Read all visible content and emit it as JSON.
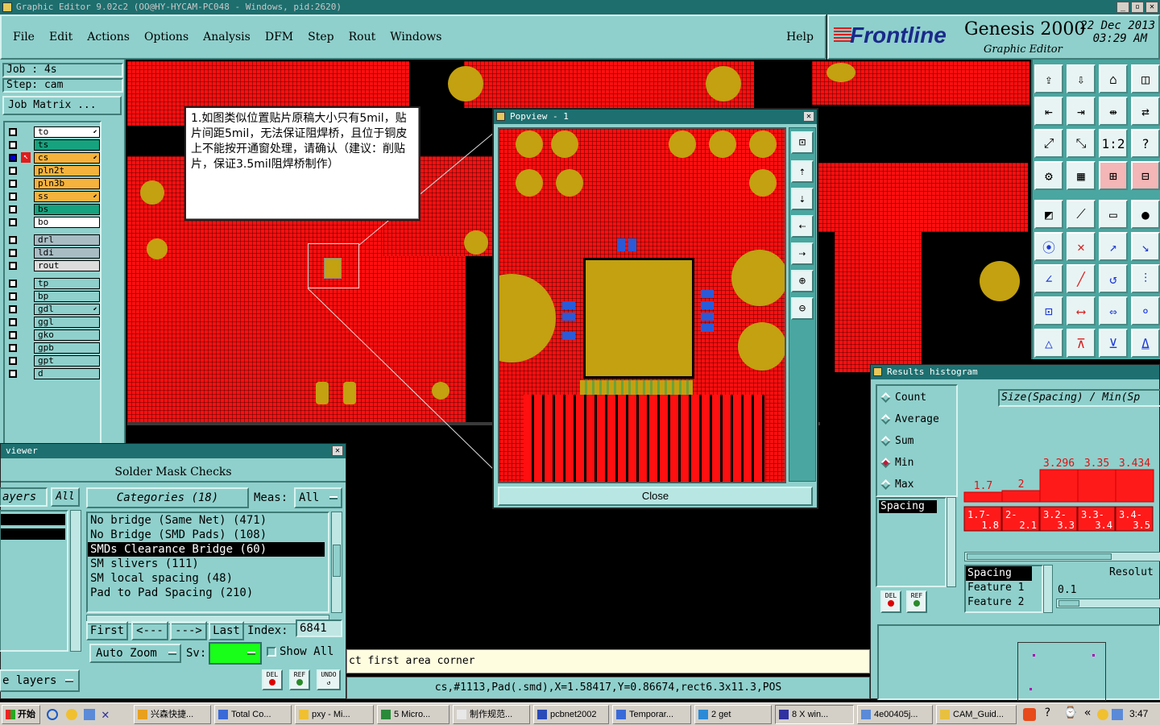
{
  "window": {
    "title": "Graphic Editor 9.02c2  (OO@HY-HYCAM-PC048 - Windows, pid:2620)"
  },
  "menu": [
    "File",
    "Edit",
    "Actions",
    "Options",
    "Analysis",
    "DFM",
    "Step",
    "Rout",
    "Windows"
  ],
  "help": "Help",
  "brand": {
    "logo": "Frontline",
    "product": "Genesis 2000",
    "subtitle": "Graphic Editor",
    "date": "22 Dec 2013",
    "time": "03:29 AM"
  },
  "job": {
    "job": "Job : 4s",
    "step": "Step: cam",
    "matrix": "Job Matrix ..."
  },
  "layers": [
    {
      "name": "to",
      "color": "#ffffff"
    },
    {
      "name": "ts",
      "color": "#16a27e"
    },
    {
      "name": "cs",
      "color": "#f5b23c"
    },
    {
      "name": "pln2t",
      "color": "#f5b23c"
    },
    {
      "name": "pln3b",
      "color": "#f5b23c"
    },
    {
      "name": "ss",
      "color": "#f5b23c"
    },
    {
      "name": "bs",
      "color": "#16a27e"
    },
    {
      "name": "bo",
      "color": "#ffffff"
    },
    {
      "name": "drl",
      "color": "#a8bcc4"
    },
    {
      "name": "ldi",
      "color": "#a8bcc4"
    },
    {
      "name": "rout",
      "color": "#dcdcdc"
    },
    {
      "name": "tp",
      "color": "#8fd0cc"
    },
    {
      "name": "bp",
      "color": "#8fd0cc"
    },
    {
      "name": "gdl",
      "color": "#8fd0cc"
    },
    {
      "name": "ggl",
      "color": "#8fd0cc"
    },
    {
      "name": "gko",
      "color": "#8fd0cc"
    },
    {
      "name": "gpb",
      "color": "#8fd0cc"
    },
    {
      "name": "gpt",
      "color": "#8fd0cc"
    },
    {
      "name": "d",
      "color": "#8fd0cc"
    }
  ],
  "annotation": "1.如图类似位置贴片原稿大小只有5mil，贴片间距5mil，无法保证阻焊桥，且位于铜皮上不能按开通窗处理，请确认（建议：削贴片，保证3.5mil阻焊桥制作）",
  "popview": {
    "title": "Popview - 1",
    "close": "Close"
  },
  "viewer": {
    "title": "viewer",
    "heading": "Solder Mask Checks",
    "layers_btn": "ayers",
    "all_btn": "All",
    "categories": "Categories (18)",
    "meas_label": "Meas:",
    "meas_value": "All",
    "items": [
      "No bridge (Same Net) (471)",
      "No Bridge (SMD Pads) (108)",
      "SMDs Clearance Bridge (60)",
      "SM slivers (111)",
      "SM local spacing (48)",
      "Pad to Pad Spacing (210)"
    ],
    "selected_index": 2,
    "nav": {
      "first": "First",
      "prev": "<---",
      "next": "--->",
      "last": "Last",
      "index_label": "Index:",
      "index_value": "6841"
    },
    "auto_zoom": "Auto Zoom",
    "sv": "Sv:",
    "show_all": "Show All",
    "e_layers": "e layers",
    "del": "DEL",
    "ref": "REF",
    "undo": "UNDO"
  },
  "status": {
    "prompt": "ct first area corner",
    "info": "cs,#1113,Pad(.smd),X=1.58417,Y=0.86674,rect6.3x11.3,POS"
  },
  "histogram": {
    "title": "Results histogram",
    "options": [
      "Count",
      "Average",
      "Sum",
      "Min",
      "Max"
    ],
    "selected_option": "Min",
    "header": "Size(Spacing) / Min(Sp",
    "list_item": "Spacing",
    "del": "DEL",
    "ref": "REF",
    "bars": [
      {
        "value": "1.7",
        "range": [
          "1.7-",
          "1.8"
        ],
        "level": 0.3
      },
      {
        "value": "2",
        "range": [
          "2-",
          "2.1"
        ],
        "level": 0.35
      },
      {
        "value": "3.296",
        "range": [
          "3.2-",
          "3.3"
        ],
        "level": 0.65
      },
      {
        "value": "3.35",
        "range": [
          "3.3-",
          "3.4"
        ],
        "level": 0.65
      },
      {
        "value": "3.434",
        "range": [
          "3.4-",
          "3.5"
        ],
        "level": 0.65
      }
    ],
    "attrs": [
      "Spacing",
      "Feature 1",
      "Feature 2"
    ],
    "resolution_label": "Resolut",
    "resolution_value": "0.1"
  },
  "taskbar": {
    "start": "开始",
    "items": [
      "兴森快捷...",
      "Total Co...",
      "pxy - Mi...",
      "5 Micro...",
      "制作规范...",
      "pcbnet2002",
      "Temporar...",
      "2 get",
      "8 X win...",
      "4e00405j...",
      "CAM_Guid..."
    ],
    "clock": "3:47"
  }
}
